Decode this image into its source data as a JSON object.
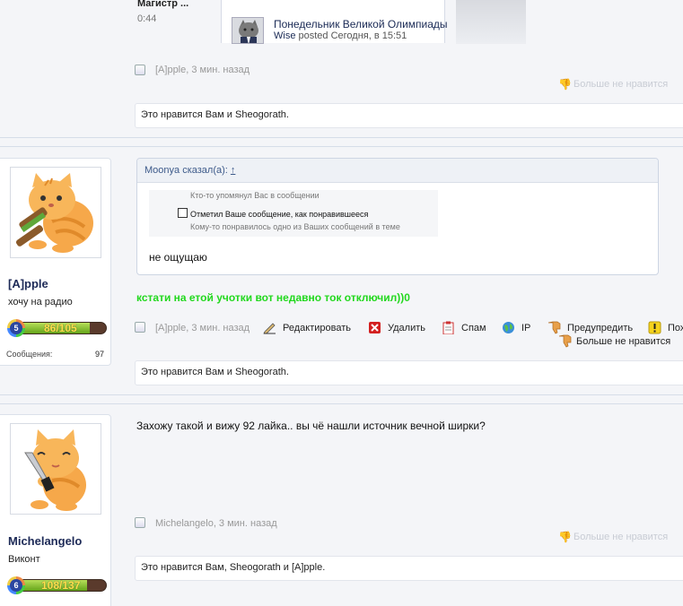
{
  "top_post": {
    "user_name": "Магистр ...",
    "time": "0:44",
    "thread_title": "Понедельник Великой Олимпиады",
    "thread_author": "Wise",
    "thread_meta": "posted Сегодня, в 15:51"
  },
  "post1": {
    "author_time": "[A]pple, 3 мин. назад",
    "dislike": "Больше не нравится",
    "likes": "Это нравится Вам и Sheogorath."
  },
  "post2": {
    "user": {
      "name": "[A]pple",
      "title": "хочу на радио",
      "level": "5",
      "level_progress": "86/105",
      "level_fraction": 0.819,
      "posts_label": "Сообщения:",
      "posts_count": "97"
    },
    "quote": {
      "header": "Moonya сказал(а):",
      "header_arrow": "↑",
      "notify1": "Кто-то упомянул Вас в сообщении",
      "notify2": "Отметил Ваше сообщение, как понравившееся",
      "notify3": "Кому-то понравилось одно из Ваших сообщений в теме",
      "reply": "не ощущаю"
    },
    "message": "кстати на етой учотки вот недавно ток отключил))0",
    "author_time": "[A]pple, 3 мин. назад",
    "actions": {
      "edit": "Редактировать",
      "delete": "Удалить",
      "spam": "Спам",
      "ip": "IP",
      "warn": "Предупредить",
      "more": "Пох"
    },
    "dislike": "Больше не нравится",
    "likes": "Это нравится Вам и Sheogorath."
  },
  "post3": {
    "user": {
      "name": "Michelangelo",
      "title": "Виконт",
      "level": "6",
      "level_progress": "108/137",
      "level_fraction": 0.788
    },
    "message": "Захожу такой и вижу 92 лайка.. вы чё нашли источник вечной ширки?",
    "author_time": "Michelangelo, 3 мин. назад",
    "dislike": "Больше не нравится",
    "likes": "Это нравится Вам, Sheogorath и [A]pple."
  },
  "colors": {
    "accent_link": "#1d2a57",
    "message_green": "#22d81e",
    "level_bar_fill": "#63a419",
    "level_text": "#ffe14a"
  }
}
